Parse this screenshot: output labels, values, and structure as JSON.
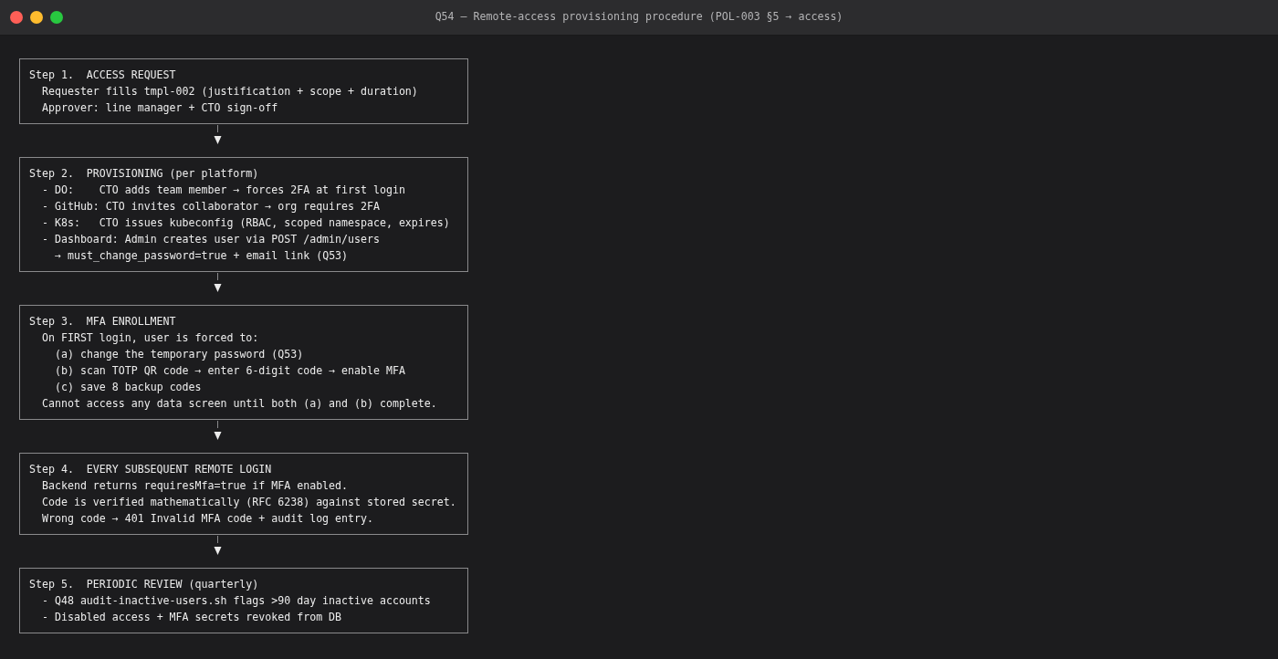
{
  "window": {
    "title": "Q54 — Remote-access provisioning procedure (POL-003 §5 → access)"
  },
  "steps": [
    {
      "heading": "Step 1.  ACCESS REQUEST",
      "lines": [
        {
          "text": "Requester fills tmpl-002 (justification + scope + duration)"
        },
        {
          "text": "Approver: line manager + CTO sign-off"
        }
      ]
    },
    {
      "heading": "Step 2.  PROVISIONING (per platform)",
      "lines": [
        {
          "text": "- DO:    CTO adds team member → forces 2FA at first login"
        },
        {
          "text": "- GitHub: CTO invites collaborator → org requires 2FA"
        },
        {
          "text": "- K8s:   CTO issues kubeconfig (RBAC, scoped namespace, expires)"
        },
        {
          "text": "- Dashboard: Admin creates user via POST /admin/users",
          "children": [
            {
              "text": "→ must_change_password=true + email link (Q53)"
            }
          ]
        }
      ]
    },
    {
      "heading": "Step 3.  MFA ENROLLMENT",
      "lines": [
        {
          "text": "On FIRST login, user is forced to:",
          "children": [
            {
              "text": "(a) change the temporary password (Q53)"
            },
            {
              "text": "(b) scan TOTP QR code → enter 6-digit code → enable MFA"
            },
            {
              "text": "(c) save 8 backup codes"
            }
          ]
        },
        {
          "text": "Cannot access any data screen until both (a) and (b) complete."
        }
      ]
    },
    {
      "heading": "Step 4.  EVERY SUBSEQUENT REMOTE LOGIN",
      "lines": [
        {
          "text": "Backend returns requiresMfa=true if MFA enabled."
        },
        {
          "text": "Code is verified mathematically (RFC 6238) against stored secret."
        },
        {
          "text": "Wrong code → 401 Invalid MFA code + audit log entry."
        }
      ]
    },
    {
      "heading": "Step 5.  PERIODIC REVIEW (quarterly)",
      "lines": [
        {
          "text": "- Q48 audit-inactive-users.sh flags >90 day inactive accounts"
        },
        {
          "text": "- Disabled access + MFA secrets revoked from DB"
        }
      ]
    }
  ]
}
